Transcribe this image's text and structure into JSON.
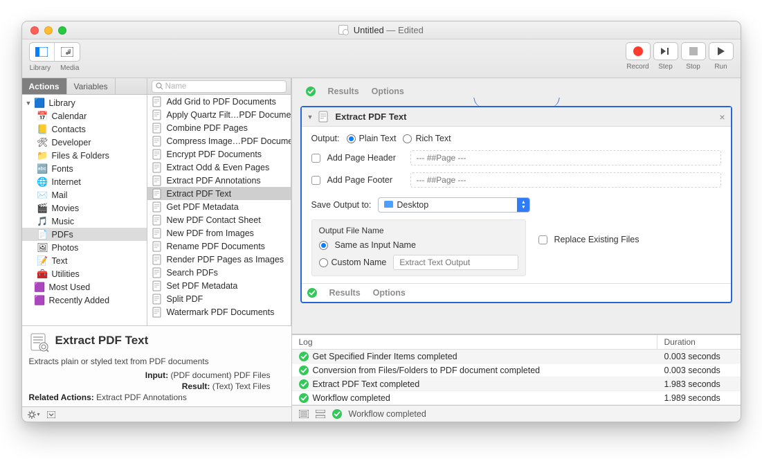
{
  "window": {
    "doc_name": "Untitled",
    "edited_label": "Edited"
  },
  "toolbar": {
    "library": "Library",
    "media": "Media",
    "record": "Record",
    "step": "Step",
    "stop": "Stop",
    "run": "Run"
  },
  "tabs": {
    "actions": "Actions",
    "variables": "Variables"
  },
  "search": {
    "placeholder": "Name"
  },
  "library": {
    "root": "Library",
    "items": [
      {
        "label": "Calendar",
        "icon": "📅"
      },
      {
        "label": "Contacts",
        "icon": "📒"
      },
      {
        "label": "Developer",
        "icon": "🛠"
      },
      {
        "label": "Files & Folders",
        "icon": "📁"
      },
      {
        "label": "Fonts",
        "icon": "🔤"
      },
      {
        "label": "Internet",
        "icon": "🌐"
      },
      {
        "label": "Mail",
        "icon": "✉️"
      },
      {
        "label": "Movies",
        "icon": "🎬"
      },
      {
        "label": "Music",
        "icon": "🎵"
      },
      {
        "label": "PDFs",
        "icon": "📄",
        "selected": true
      },
      {
        "label": "Photos",
        "icon": "🖼"
      },
      {
        "label": "Text",
        "icon": "📝"
      },
      {
        "label": "Utilities",
        "icon": "🧰"
      }
    ],
    "extras": [
      {
        "label": "Most Used",
        "icon": "🟪"
      },
      {
        "label": "Recently Added",
        "icon": "🟪"
      }
    ]
  },
  "actions": [
    "Add Grid to PDF Documents",
    "Apply Quartz Filt…PDF Documents",
    "Combine PDF Pages",
    "Compress Image…PDF Documents",
    "Encrypt PDF Documents",
    "Extract Odd & Even Pages",
    "Extract PDF Annotations",
    "Extract PDF Text",
    "Get PDF Metadata",
    "New PDF Contact Sheet",
    "New PDF from Images",
    "Rename PDF Documents",
    "Render PDF Pages as Images",
    "Search PDFs",
    "Set PDF Metadata",
    "Split PDF",
    "Watermark PDF Documents"
  ],
  "actions_selected_index": 7,
  "info": {
    "title": "Extract PDF Text",
    "desc": "Extracts plain or styled text from PDF documents",
    "input_label": "Input:",
    "input_value": "(PDF document) PDF Files",
    "result_label": "Result:",
    "result_value": "(Text) Text Files",
    "related_label": "Related Actions:",
    "related_value": "Extract PDF Annotations"
  },
  "upper_results": {
    "results": "Results",
    "options": "Options"
  },
  "card": {
    "title": "Extract PDF Text",
    "output_label": "Output:",
    "plain_text": "Plain Text",
    "rich_text": "Rich Text",
    "add_header": "Add Page Header",
    "header_placeholder": "--- ##Page ---",
    "add_footer": "Add Page Footer",
    "footer_placeholder": "--- ##Page ---",
    "save_to_label": "Save Output to:",
    "save_to_value": "Desktop",
    "ofn_title": "Output File Name",
    "same_as_input": "Same as Input Name",
    "custom_name": "Custom Name",
    "custom_placeholder": "Extract Text Output",
    "replace": "Replace Existing Files",
    "results": "Results",
    "options": "Options"
  },
  "log": {
    "col_log": "Log",
    "col_dur": "Duration",
    "rows": [
      {
        "msg": "Get Specified Finder Items completed",
        "dur": "0.003 seconds"
      },
      {
        "msg": "Conversion from Files/Folders to PDF document completed",
        "dur": "0.003 seconds"
      },
      {
        "msg": "Extract PDF Text completed",
        "dur": "1.983 seconds"
      },
      {
        "msg": "Workflow completed",
        "dur": "1.989 seconds"
      }
    ]
  },
  "status": "Workflow completed"
}
